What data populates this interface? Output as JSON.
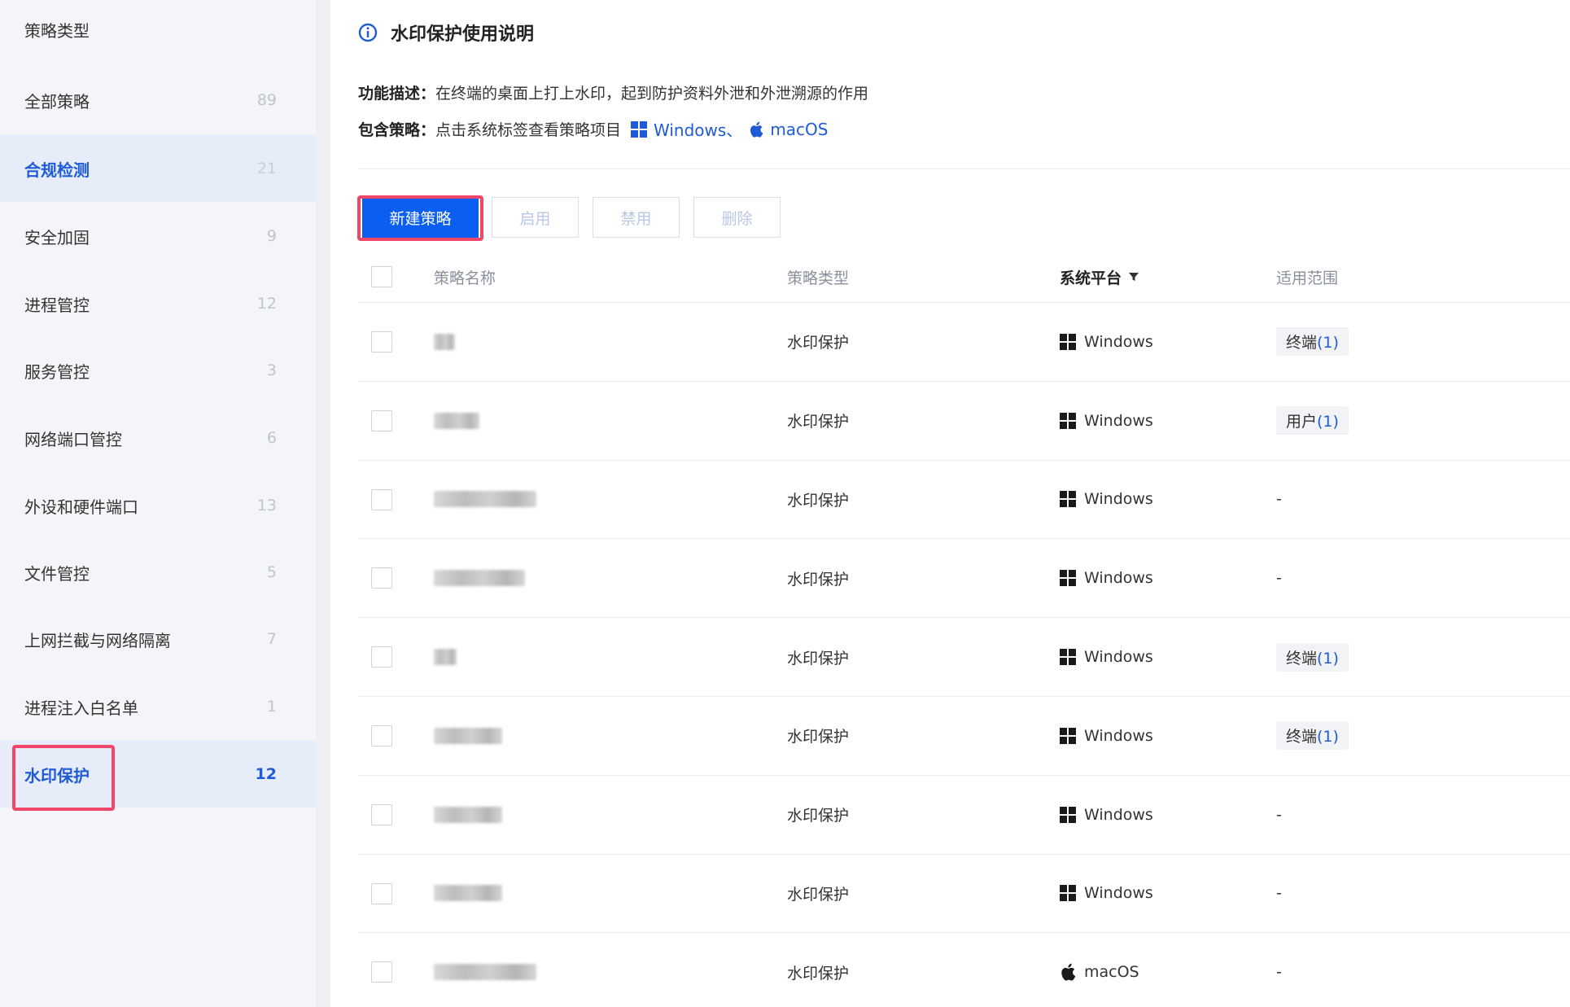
{
  "sidebar": {
    "header": "策略类型",
    "items": [
      {
        "label": "全部策略",
        "count": "89"
      },
      {
        "label": "合规检测",
        "count": "21"
      },
      {
        "label": "安全加固",
        "count": "9"
      },
      {
        "label": "进程管控",
        "count": "12"
      },
      {
        "label": "服务管控",
        "count": "3"
      },
      {
        "label": "网络端口管控",
        "count": "6"
      },
      {
        "label": "外设和硬件端口",
        "count": "13"
      },
      {
        "label": "文件管控",
        "count": "5"
      },
      {
        "label": "上网拦截与网络隔离",
        "count": "7"
      },
      {
        "label": "进程注入白名单",
        "count": "1"
      },
      {
        "label": "水印保护",
        "count": "12"
      }
    ]
  },
  "notes": {
    "title": "水印保护使用说明",
    "func_key": "功能描述：",
    "func_value": "在终端的桌面上打上水印，起到防护资料外泄和外泄溯源的作用",
    "include_key": "包含策略：",
    "include_value": "点击系统标签查看策略项目",
    "windows_link": "Windows、",
    "macos_link": "macOS"
  },
  "toolbar": {
    "new_label": "新建策略",
    "enable_label": "启用",
    "disable_label": "禁用",
    "delete_label": "删除"
  },
  "table": {
    "columns": {
      "name": "策略名称",
      "type": "策略类型",
      "platform": "系统平台",
      "scope": "适用范围"
    },
    "rows": [
      {
        "type": "水印保护",
        "platform": "Windows",
        "scope_label": "终端",
        "scope_count": "(1)",
        "scope_dash": ""
      },
      {
        "type": "水印保护",
        "platform": "Windows",
        "scope_label": "用户",
        "scope_count": "(1)",
        "scope_dash": ""
      },
      {
        "type": "水印保护",
        "platform": "Windows",
        "scope_label": "",
        "scope_count": "",
        "scope_dash": "-"
      },
      {
        "type": "水印保护",
        "platform": "Windows",
        "scope_label": "",
        "scope_count": "",
        "scope_dash": "-"
      },
      {
        "type": "水印保护",
        "platform": "Windows",
        "scope_label": "终端",
        "scope_count": "(1)",
        "scope_dash": ""
      },
      {
        "type": "水印保护",
        "platform": "Windows",
        "scope_label": "终端",
        "scope_count": "(1)",
        "scope_dash": ""
      },
      {
        "type": "水印保护",
        "platform": "Windows",
        "scope_label": "",
        "scope_count": "",
        "scope_dash": "-"
      },
      {
        "type": "水印保护",
        "platform": "Windows",
        "scope_label": "",
        "scope_count": "",
        "scope_dash": "-"
      },
      {
        "type": "水印保护",
        "platform": "macOS",
        "scope_label": "",
        "scope_count": "",
        "scope_dash": "-"
      }
    ]
  },
  "colors": {
    "accent": "#1f5bd8",
    "primary_button": "#0a5ff2",
    "highlight": "#f0466a"
  }
}
